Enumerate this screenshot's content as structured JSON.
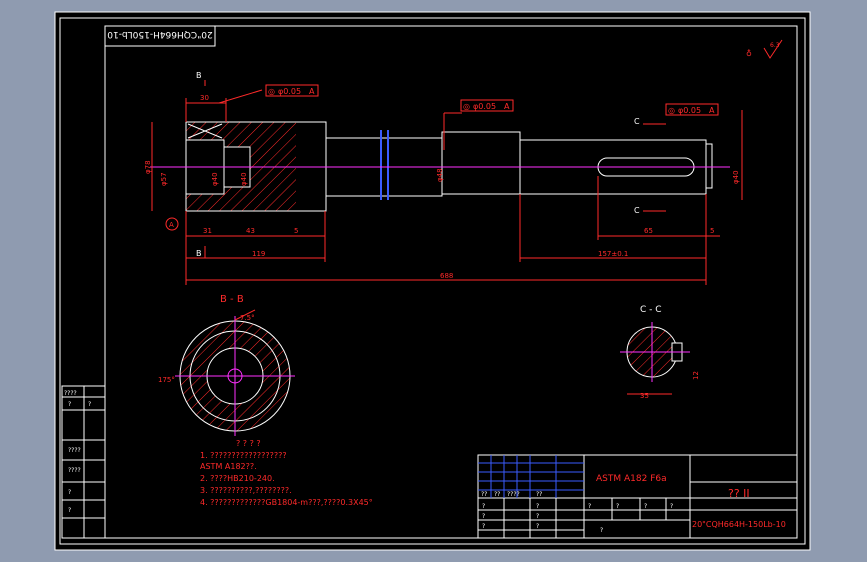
{
  "drawing": {
    "stamp_rotated": "20\"CQH664H-150Lb-10",
    "roughness": "6.3",
    "section_b_title": "B - B",
    "section_c_title": "C - C",
    "cut_b": "B",
    "cut_c": "C",
    "datum": "A",
    "tolerances": [
      {
        "sym": "◎",
        "value": "φ0.05",
        "ref": "A"
      },
      {
        "sym": "◎",
        "value": "φ0.05",
        "ref": "A"
      },
      {
        "sym": "◎",
        "value": "φ0.05",
        "ref": "A"
      }
    ],
    "dims": {
      "d30": "30",
      "d31": "31",
      "d43": "43",
      "d5a": "5",
      "d119": "119",
      "d688": "688",
      "d65": "65",
      "d5b": "5",
      "d157": "157±0.1",
      "phi78": "φ78",
      "phi57": "φ57",
      "phi40a": "φ40",
      "phi40b": "φ40",
      "phi48": "φ48",
      "phi40c": "φ40",
      "ang75": "7.5°",
      "ang175": "175°",
      "d35": "35",
      "d12": "12"
    },
    "notes_title": "? ? ? ?",
    "notes": [
      "1. ??????????????????",
      "   ASTM A182??.",
      "2. ????HB210-240.",
      "3. ??????????,????????.",
      "4. ?????????????GB1804-m???,????0.3X45°"
    ]
  },
  "title_block": {
    "material": "ASTM A182 F6a",
    "part_name": "?? II",
    "drawing_no": "20\"CQH664H-150Lb-10",
    "left_labels": [
      "????",
      "?",
      "?",
      "????",
      "????",
      "?",
      "?"
    ],
    "header_cells": [
      "??",
      "??",
      "????",
      "??"
    ],
    "qmark": "?"
  }
}
